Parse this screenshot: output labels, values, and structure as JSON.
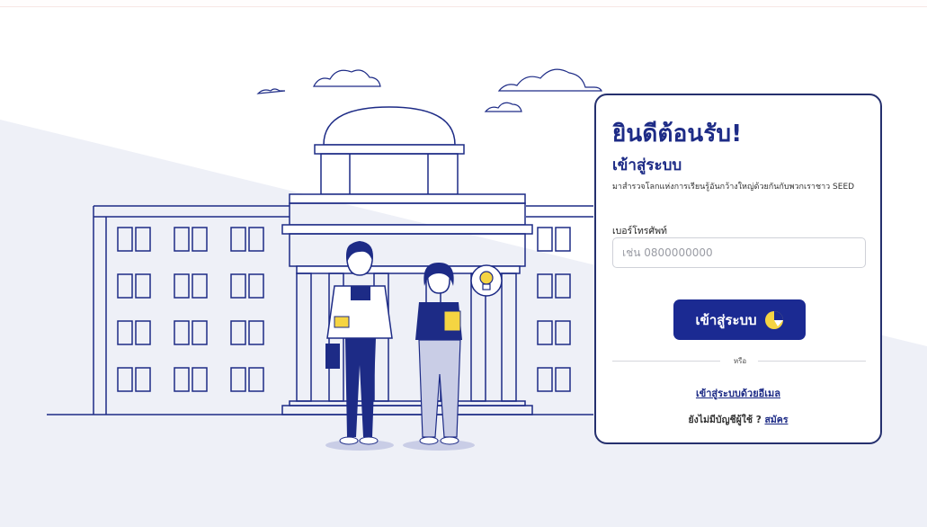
{
  "colors": {
    "brand": "#1b2a92",
    "accent_yellow": "#f5d442",
    "background_shape": "#eef0f7"
  },
  "illustration": {
    "subject": "university building with two students",
    "icon": "lightbulb-icon"
  },
  "login_card": {
    "title": "ยินดีต้อนรับ!",
    "heading": "เข้าสู่ระบบ",
    "description": "มาสำรวจโลกแห่งการเรียนรู้อันกว้างใหญ่ด้วยกันกับพวกเราชาว SEED",
    "phone_label": "เบอร์โทรศัพท์",
    "phone_placeholder": "เช่น 0800000000",
    "phone_value": "",
    "login_button": "เข้าสู่ระบบ",
    "or_text": "หรือ",
    "email_login_link": "เข้าสู่ระบบด้วยอีเมล",
    "no_account_text": "ยังไม่มีบัญชีผู้ใช้ ?",
    "signup_link": "สมัคร"
  }
}
